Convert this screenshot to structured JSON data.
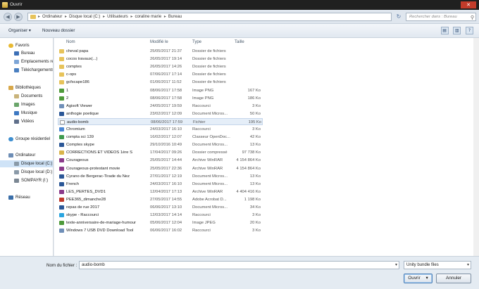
{
  "window": {
    "title": "Ouvrir",
    "close_glyph": "✕"
  },
  "address": {
    "crumbs": [
      "Ordinateur",
      "Disque local (C:)",
      "Utilisateurs",
      "coraline marie",
      "Bureau"
    ],
    "separator": "▸",
    "search_placeholder": "Rechercher dans : Bureau",
    "back_glyph": "◀",
    "forward_glyph": "▶",
    "refresh_glyph": "↻",
    "search_glyph": "⚲"
  },
  "commands": {
    "organize": "Organiser ▾",
    "new_folder": "Nouveau dossier",
    "view_icon": "▤",
    "layout_icon": "▥",
    "help_icon": "?"
  },
  "nav": {
    "favorites": "Favoris",
    "favorites_items": [
      "Bureau",
      "Emplacements ré",
      "Téléchargements"
    ],
    "libraries": "Bibliothèques",
    "libraries_items": [
      "Documents",
      "Images",
      "Musique",
      "Vidéos"
    ],
    "homegroup": "Groupe résidentiel",
    "computer": "Ordinateur",
    "computer_items": [
      "Disque local (C:)",
      "Disque local (D:)",
      "SOMPAYR (I:)"
    ],
    "network": "Réseau"
  },
  "columns": {
    "name": "Nom",
    "date": "Modifié le",
    "type": "Type",
    "size": "Taille"
  },
  "files": [
    {
      "name": "cheval papa",
      "date": "25/05/2017 21:37",
      "type": "Dossier de fichiers",
      "size": "",
      "icon": "folder-icon"
    },
    {
      "name": "cocos travaux(...)",
      "date": "26/05/2017 19:14",
      "type": "Dossier de fichiers",
      "size": "",
      "icon": "folder-icon"
    },
    {
      "name": "comptes",
      "date": "26/05/2017 14:26",
      "type": "Dossier de fichiers",
      "size": "",
      "icon": "folder-icon"
    },
    {
      "name": "c-ops",
      "date": "07/06/2017 17:14",
      "type": "Dossier de fichiers",
      "size": "",
      "icon": "folder-icon"
    },
    {
      "name": "gcfscape186",
      "date": "01/06/2017 11:52",
      "type": "Dossier de fichiers",
      "size": "",
      "icon": "folder-icon"
    },
    {
      "name": "1",
      "date": "08/06/2017 17:58",
      "type": "Image PNG",
      "size": "167 Ko",
      "icon": "image-icon"
    },
    {
      "name": "2",
      "date": "08/06/2017 17:58",
      "type": "Image PNG",
      "size": "186 Ko",
      "icon": "image-icon"
    },
    {
      "name": "Agisoft Viewer",
      "date": "24/05/2017 19:59",
      "type": "Raccourci",
      "size": "3 Ko",
      "icon": "shortcut-icon"
    },
    {
      "name": "anthogie poetique",
      "date": "23/02/2017 12:09",
      "type": "Document Micros...",
      "size": "50 Ko",
      "icon": "word-icon"
    },
    {
      "name": "audio-bomb",
      "date": "08/06/2017 17:59",
      "type": "Fichier",
      "size": "195 Ko",
      "icon": "file-icon"
    },
    {
      "name": "Chromium",
      "date": "24/03/2017 16:10",
      "type": "Raccourci",
      "size": "3 Ko",
      "icon": "chromium-icon"
    },
    {
      "name": "compta sci 139",
      "date": "16/02/2017 12:07",
      "type": "Classeur OpenDoc...",
      "size": "42 Ko",
      "icon": "spreadsheet-icon"
    },
    {
      "name": "Comptes skype",
      "date": "29/10/2016 10:49",
      "type": "Document Micros...",
      "size": "13 Ko",
      "icon": "word-icon"
    },
    {
      "name": "CORRECTIONS ET VIDEOS 1ère S",
      "date": "17/04/2017 09:26",
      "type": "Dossier compressé",
      "size": "97 738 Ko",
      "icon": "zip-icon"
    },
    {
      "name": "Courageous",
      "date": "25/05/2017 14:44",
      "type": "Archive WinRAR",
      "size": "4 154 864 Ko",
      "icon": "rar-icon"
    },
    {
      "name": "Courageous-protestant movie",
      "date": "25/05/2017 22:36",
      "type": "Archive WinRAR",
      "size": "4 154 864 Ko",
      "icon": "rar-icon"
    },
    {
      "name": "Cyrano de Bergerac-Tirade du Nez",
      "date": "27/01/2017 12:19",
      "type": "Document Micros...",
      "size": "13 Ko",
      "icon": "word-icon"
    },
    {
      "name": "French",
      "date": "24/03/2017 16:10",
      "type": "Document Micros...",
      "size": "13 Ko",
      "icon": "word-icon"
    },
    {
      "name": "LES_PERTES_DVD1",
      "date": "12/04/2017 17:13",
      "type": "Archive WinRAR",
      "size": "4 404 416 Ko",
      "icon": "rar-icon"
    },
    {
      "name": "PEE365_dimanche28",
      "date": "27/05/2017 14:55",
      "type": "Adobe Acrobat D...",
      "size": "1 198 Ko",
      "icon": "pdf-icon"
    },
    {
      "name": "repas de rue 2017",
      "date": "06/06/2017 13:10",
      "type": "Document Micros...",
      "size": "34 Ko",
      "icon": "word-icon"
    },
    {
      "name": "skype - Raccourci",
      "date": "12/03/2017 14:14",
      "type": "Raccourci",
      "size": "3 Ko",
      "icon": "skype-icon"
    },
    {
      "name": "texte-anniversaire-de-mariage-humour",
      "date": "05/06/2017 12:04",
      "type": "Image JPEG",
      "size": "20 Ko",
      "icon": "image-icon"
    },
    {
      "name": "Windows 7 USB DVD Download Tool",
      "date": "06/06/2017 16:02",
      "type": "Raccourci",
      "size": "3 Ko",
      "icon": "shortcut-icon"
    }
  ],
  "selected_index": 9,
  "bottom": {
    "filename_label": "Nom du fichier :",
    "filename_value": "audio-bomb",
    "filter_value": "Unity bundle files",
    "dropdown_glyph": "▾",
    "open_label": "Ouvrir",
    "open_arrow": "▾",
    "cancel_label": "Annuler"
  },
  "colors": {
    "folder": "#e7c35a",
    "selection": "#cfe3f7",
    "word": "#2b5797",
    "rar": "#8b3a8b",
    "pdf": "#c0392b",
    "image": "#4e9a3a",
    "zip": "#d9b44a"
  }
}
